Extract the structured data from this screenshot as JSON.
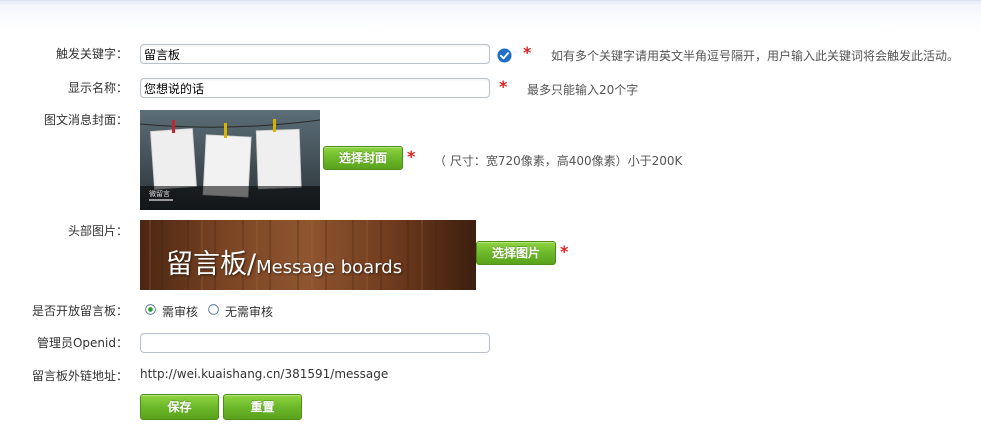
{
  "form": {
    "keyword": {
      "label": "触发关键字：",
      "value": "留言板",
      "required": "*",
      "hint": "如有多个关键字请用英文半角逗号隔开，用户输入此关键词将会触发此活动。"
    },
    "display_name": {
      "label": "显示名称：",
      "value": "您想说的话",
      "required": "*",
      "hint": "最多只能输入20个字"
    },
    "cover": {
      "label": "图文消息封面：",
      "button": "选择封面",
      "required": "*",
      "hint": "（ 尺寸：宽720像素，高400像素）小于200K",
      "image_caption": "微留言"
    },
    "header_image": {
      "label": "头部图片：",
      "button": "选择图片",
      "required": "*",
      "banner_cn": "留言板/",
      "banner_en": "Message boards"
    },
    "open_board": {
      "label": "是否开放留言板：",
      "options": [
        "需审核",
        "无需审核"
      ],
      "selected": "需审核"
    },
    "admin_openid": {
      "label": "管理员Openid：",
      "value": ""
    },
    "external_link": {
      "label": "留言板外链地址：",
      "value": "http://wei.kuaishang.cn/381591/message"
    },
    "actions": {
      "save": "保存",
      "reset": "重置"
    }
  },
  "colors": {
    "accent_green": "#6cb82a",
    "required_red": "#e02020",
    "check_blue": "#1f6fc5"
  },
  "icons": {
    "keyword_valid": "check-circle-icon"
  }
}
